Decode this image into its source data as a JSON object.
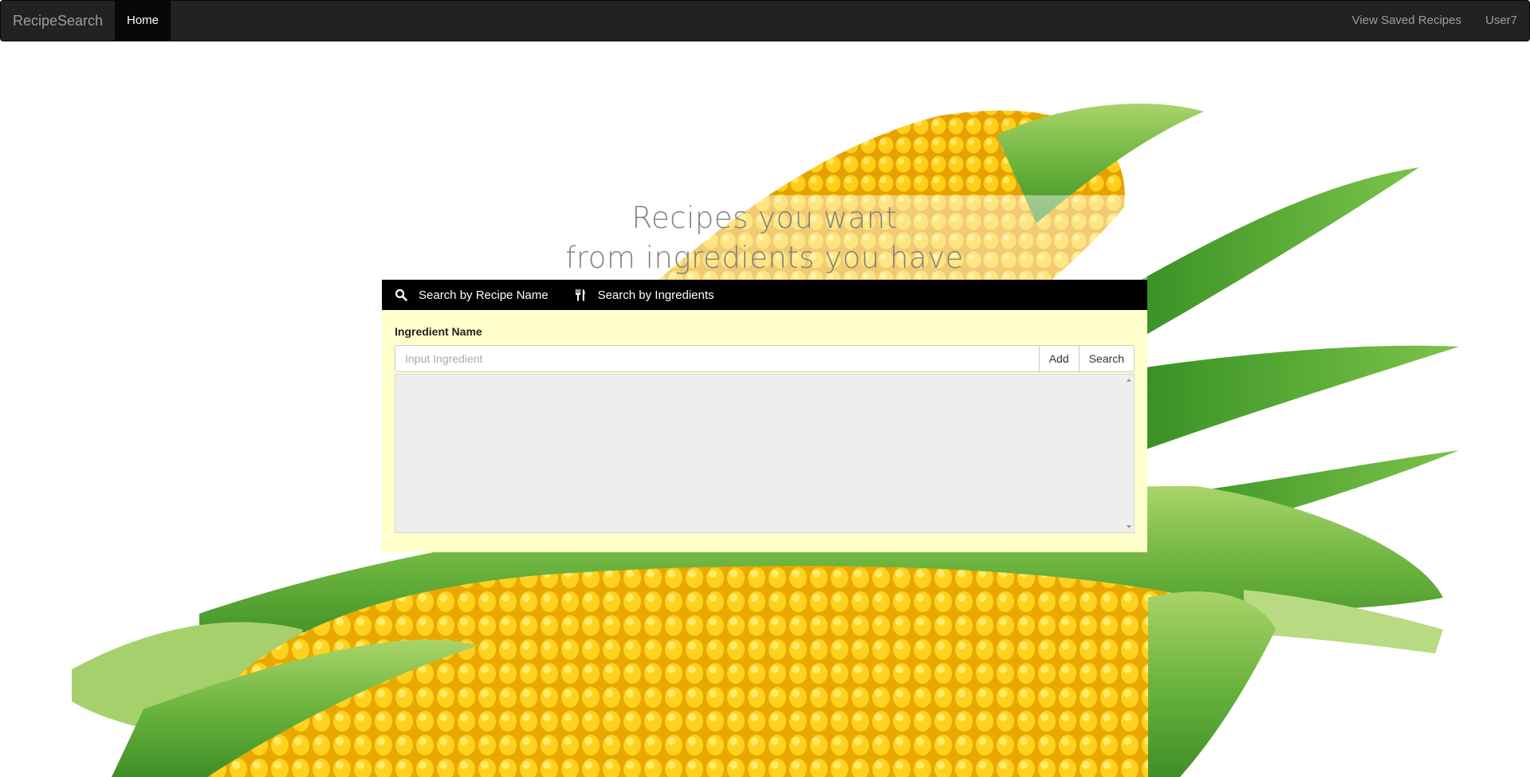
{
  "navbar": {
    "brand": "RecipeSearch",
    "home": "Home",
    "saved": "View Saved Recipes",
    "user": "User7"
  },
  "hero": {
    "line1": "Recipes you want",
    "line2": "from ingredients you have"
  },
  "tabs": [
    {
      "label": "Search by Recipe Name",
      "icon": "search-icon"
    },
    {
      "label": "Search by Ingredients",
      "icon": "cutlery-icon"
    }
  ],
  "form": {
    "label": "Ingredient Name",
    "placeholder": "Input Ingredient",
    "value": "",
    "add_label": "Add",
    "search_label": "Search"
  },
  "colors": {
    "navbar": "#222222",
    "tabbar": "#000000",
    "panel": "#ffffcc",
    "hero_text": "#808080",
    "corn_yellow": "#f7c400",
    "husk_green": "#3f9a2a"
  }
}
